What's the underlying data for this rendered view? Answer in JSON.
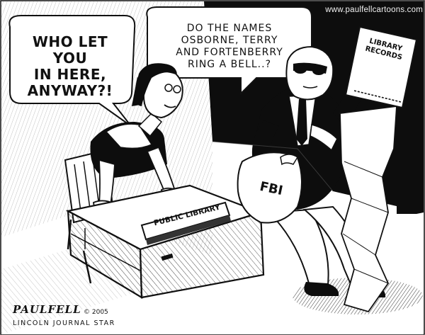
{
  "site_url": "www.paulfellcartoons.com",
  "speech_left": {
    "lines": [
      "WHO LET YOU",
      "IN HERE,",
      "ANYWAY?!"
    ]
  },
  "speech_fbi": {
    "lines": [
      "DO THE NAMES",
      "OSBORNE, TERRY",
      "AND FORTENBERRY",
      "RING A BELL..?"
    ]
  },
  "records_sign": [
    "LIBRARY",
    "RECORDS"
  ],
  "desk_sign": "PUBLIC LIBRARY",
  "fbi_bag_label": "FBI",
  "signature": "PAULFELL",
  "copyright": "© 2005",
  "newspaper": "LINCOLN JOURNAL STAR",
  "colors": {
    "ink": "#111111",
    "paper": "#ffffff",
    "dark_bg": "#0d0d0d"
  }
}
